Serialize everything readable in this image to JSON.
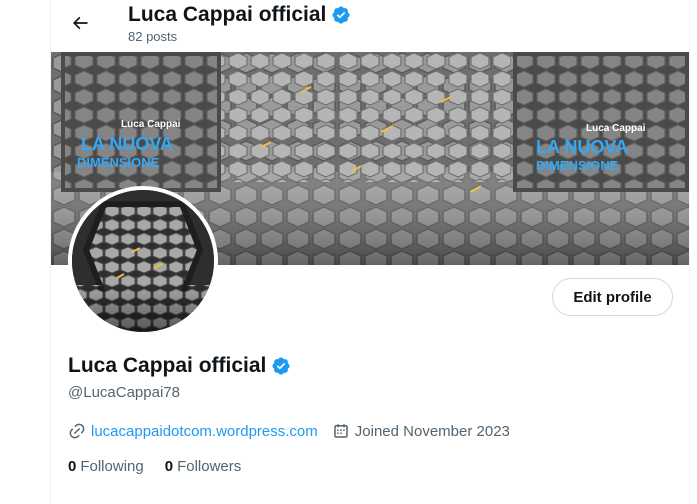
{
  "colors": {
    "text_primary": "#0f1419",
    "text_secondary": "#536471",
    "link": "#1d9bf0",
    "verified_badge": "#1d9bf0",
    "border": "#cfd9de"
  },
  "header": {
    "back_icon": "arrow-left-icon",
    "name": "Luca Cappai official",
    "posts_count": "82 posts",
    "verified_icon": "verified-badge-icon"
  },
  "banner": {
    "left_text_top": "Luca Cappai",
    "left_text_main": "LA NUOVA",
    "left_text_sub": "DIMENSIONE",
    "right_text_top": "Luca Cappai",
    "right_text_main": "LA NUOVA",
    "right_text_sub": "DIMENSIONE"
  },
  "profile": {
    "edit_button_label": "Edit profile",
    "name": "Luca Cappai official",
    "handle": "@LucaCappai78",
    "website_icon": "link-icon",
    "website": "lucacappaidotcom.wordpress.com",
    "calendar_icon": "calendar-icon",
    "joined": "Joined November 2023",
    "following_count": "0",
    "following_label": "Following",
    "followers_count": "0",
    "followers_label": "Followers"
  }
}
